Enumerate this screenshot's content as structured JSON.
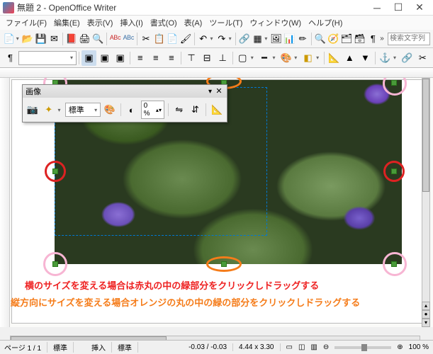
{
  "window": {
    "title": "無題 2 - OpenOffice Writer"
  },
  "menu": {
    "file": "ファイル(F)",
    "edit": "編集(E)",
    "view": "表示(V)",
    "insert": "挿入(I)",
    "format": "書式(O)",
    "table": "表(A)",
    "tools": "ツール(T)",
    "window": "ウィンドウ(W)",
    "help": "ヘルプ(H)"
  },
  "search": {
    "placeholder": "検索文字列"
  },
  "toolbar2": {
    "style_combo": ""
  },
  "float_image": {
    "title": "画像",
    "filter_combo": "標準",
    "pct_value": "0 %"
  },
  "annotations": {
    "red": "横のサイズを変える場合は赤丸の中の緑部分をクリックしドラッグする",
    "orange": "縦方向にサイズを変える場合オレンジの丸の中の緑の部分をクリックしドラッグする"
  },
  "status": {
    "page": "ページ 1 / 1",
    "style": "標準",
    "lang": "",
    "mode": "挿入",
    "sel": "標準",
    "pos": "-0.03 / -0.03",
    "size": "4.44 x 3.30",
    "zoom": "100 %"
  }
}
